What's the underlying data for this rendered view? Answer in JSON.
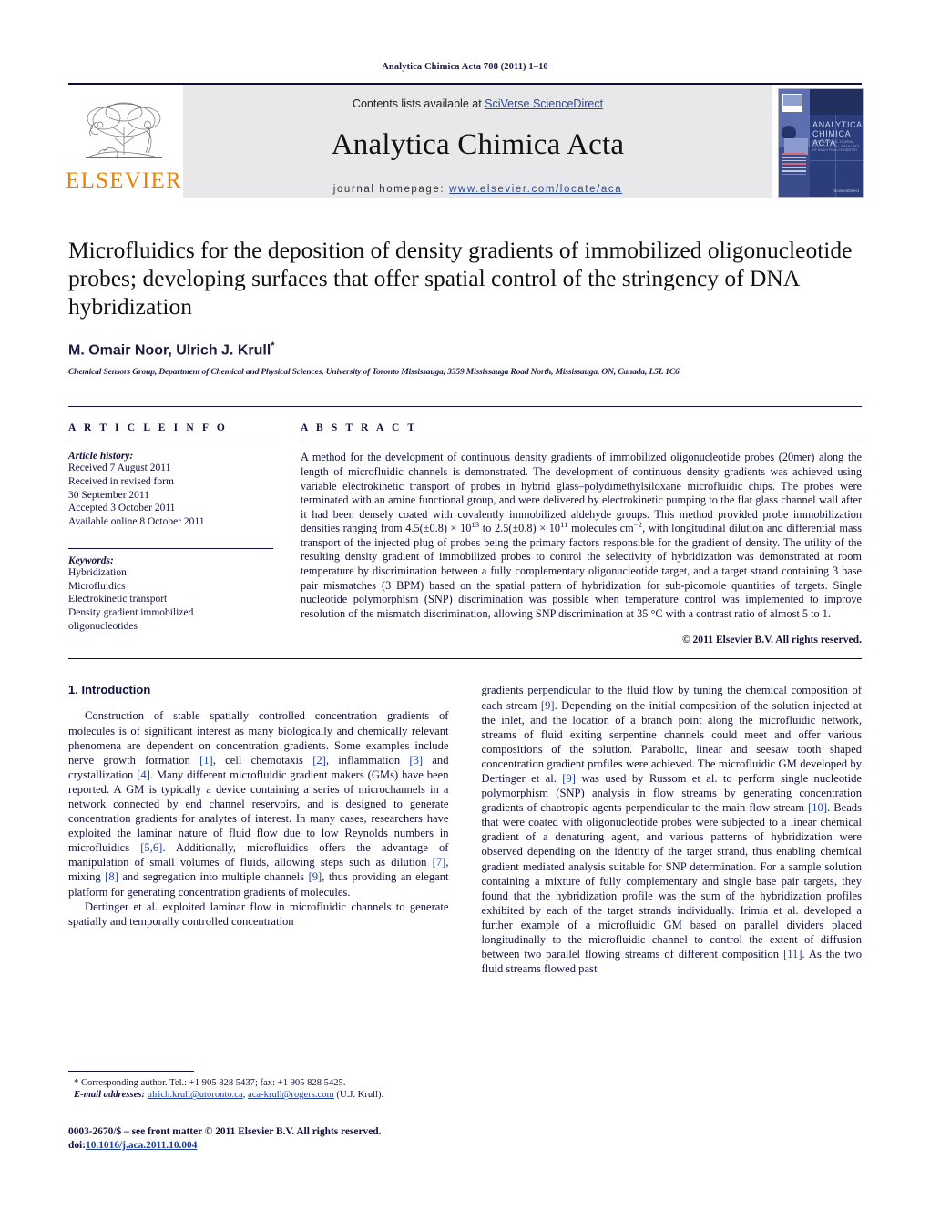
{
  "running_head": "Analytica Chimica Acta 708 (2011) 1–10",
  "masthead": {
    "publisher_name": "ELSEVIER",
    "contents_prefix": "Contents lists available at ",
    "contents_link": "SciVerse ScienceDirect",
    "journal_title": "Analytica Chimica Acta",
    "homepage_prefix": "journal homepage: ",
    "homepage_url": "www.elsevier.com/locate/aca",
    "cover": {
      "title": "ANALYTICA",
      "title2": "CHIMICA ACTA",
      "subtitle": "INTERNATIONAL JOURNAL DEVOTED TO ALL BRANCHES OF ANALYTICAL CHEMISTRY",
      "publisher_mark": "ELSEVIER",
      "footer": "ScienceDirect"
    }
  },
  "article": {
    "title": "Microfluidics for the deposition of density gradients of immobilized oligonucleotide probes; developing surfaces that offer spatial control of the stringency of DNA hybridization",
    "authors": "M. Omair Noor, Ulrich J. Krull",
    "author_star": "*",
    "affiliation": "Chemical Sensors Group, Department of Chemical and Physical Sciences, University of Toronto Mississauga, 3359 Mississauga Road North, Mississauga, ON, Canada, L5L 1C6"
  },
  "article_info": {
    "heading": "A R T I C L E    I N F O",
    "history_label": "Article history:",
    "history": [
      "Received 7 August 2011",
      "Received in revised form",
      "30 September 2011",
      "Accepted 3 October 2011",
      "Available online 8 October 2011"
    ],
    "keywords_label": "Keywords:",
    "keywords": [
      "Hybridization",
      "Microfluidics",
      "Electrokinetic transport",
      "Density gradient immobilized",
      "oligonucleotides"
    ]
  },
  "abstract": {
    "heading": "A B S T R A C T",
    "part1": "A method for the development of continuous density gradients of immobilized oligonucleotide probes (20mer) along the length of microfluidic channels is demonstrated. The development of continuous density gradients was achieved using variable electrokinetic transport of probes in hybrid glass–polydimethylsiloxane microfluidic chips. The probes were terminated with an amine functional group, and were delivered by electrokinetic pumping to the flat glass channel wall after it had been densely coated with covalently immobilized aldehyde groups. This method provided probe immobilization densities ranging from 4.5(±0.8) × 10",
    "exp1": "13",
    "part2": " to 2.5(±0.8) × 10",
    "exp2": "11",
    "part3": " molecules cm",
    "exp3": "−2",
    "part4": ", with longitudinal dilution and differential mass transport of the injected plug of probes being the primary factors responsible for the gradient of density. The utility of the resulting density gradient of immobilized probes to control the selectivity of hybridization was demonstrated at room temperature by discrimination between a fully complementary oligonucleotide target, and a target strand containing 3 base pair mismatches (3 BPM) based on the spatial pattern of hybridization for sub-picomole quantities of targets. Single nucleotide polymorphism (SNP) discrimination was possible when temperature control was implemented to improve resolution of the mismatch discrimination, allowing SNP discrimination at 35 °C with a contrast ratio of almost 5 to 1.",
    "copyright": "© 2011 Elsevier B.V. All rights reserved."
  },
  "introduction": {
    "heading": "1.  Introduction",
    "left_p1_a": "Construction of stable spatially controlled concentration gradients of molecules is of significant interest as many biologically and chemically relevant phenomena are dependent on concentration gradients. Some examples include nerve growth formation ",
    "ref1": "[1]",
    "left_p1_b": ", cell chemotaxis ",
    "ref2": "[2]",
    "left_p1_c": ", inflammation ",
    "ref3": "[3]",
    "left_p1_d": " and crystallization ",
    "ref4": "[4]",
    "left_p1_e": ". Many different microfluidic gradient makers (GMs) have been reported. A GM is typically a device containing a series of microchannels in a network connected by end channel reservoirs, and is designed to generate concentration gradients for analytes of interest. In many cases, researchers have exploited the laminar nature of fluid flow due to low Reynolds numbers in microfluidics ",
    "ref56": "[5,6]",
    "left_p1_f": ". Additionally, microfluidics offers the advantage of manipulation of small volumes of fluids, allowing steps such as dilution ",
    "ref7": "[7]",
    "left_p1_g": ", mixing ",
    "ref8": "[8]",
    "left_p1_h": " and segregation into multiple channels ",
    "ref9a": "[9]",
    "left_p1_i": ", thus providing an elegant platform for generating concentration gradients of molecules.",
    "left_p2": "Dertinger et al. exploited laminar flow in microfluidic channels to generate spatially and temporally controlled concentration",
    "right_p1_a": "gradients perpendicular to the fluid flow by tuning the chemical composition of each stream ",
    "ref9b": "[9]",
    "right_p1_b": ". Depending on the initial composition of the solution injected at the inlet, and the location of a branch point along the microfluidic network, streams of fluid exiting serpentine channels could meet and offer various compositions of the solution. Parabolic, linear and seesaw tooth shaped concentration gradient profiles were achieved. The microfluidic GM developed by Dertinger et al. ",
    "ref9c": "[9]",
    "right_p1_c": " was used by Russom et al. to perform single nucleotide polymorphism (SNP) analysis in flow streams by generating concentration gradients of chaotropic agents perpendicular to the main flow stream ",
    "ref10": "[10]",
    "right_p1_d": ". Beads that were coated with oligonucleotide probes were subjected to a linear chemical gradient of a denaturing agent, and various patterns of hybridization were observed depending on the identity of the target strand, thus enabling chemical gradient mediated analysis suitable for SNP determination. For a sample solution containing a mixture of fully complementary and single base pair targets, they found that the hybridization profile was the sum of the hybridization profiles exhibited by each of the target strands individually. Irimia et al. developed a further example of a microfluidic GM based on parallel dividers placed longitudinally to the microfluidic channel to control the extent of diffusion between two parallel flowing streams of different composition ",
    "ref11": "[11]",
    "right_p1_e": ". As the two fluid streams flowed past"
  },
  "footnotes": {
    "corresponding": "* Corresponding author. Tel.: +1 905 828 5437; fax: +1 905 828 5425.",
    "email_label": "E-mail addresses:",
    "email1": "ulrich.krull@utoronto.ca",
    "email_sep": ", ",
    "email2": "aca-krull@rogers.com",
    "email_suffix": " (U.J. Krull).",
    "issn": "0003-2670/$ – see front matter © 2011 Elsevier B.V. All rights reserved.",
    "doi_label": "doi:",
    "doi_value": "10.1016/j.aca.2011.10.004"
  },
  "colors": {
    "ink": "#101040",
    "link": "#1f3fa0",
    "elsevier_orange": "#f08000",
    "band_gray": "#e8e8ea"
  }
}
